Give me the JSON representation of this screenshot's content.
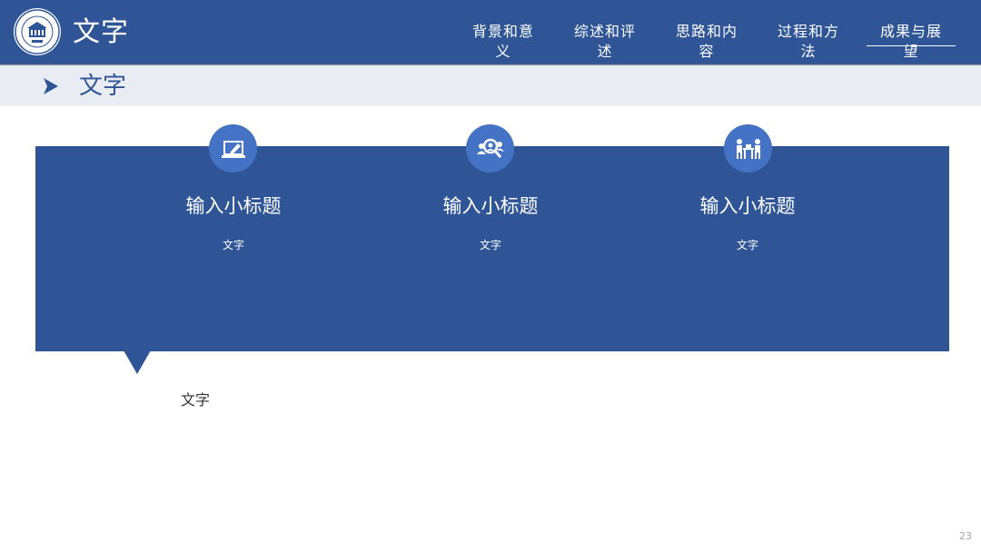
{
  "header": {
    "title": "文字",
    "logo_icon": "university-seal-icon",
    "colors": {
      "brand": "#2f5597",
      "light": "#e9edf3",
      "accent": "#4472c4"
    }
  },
  "nav": {
    "items": [
      {
        "label": "背景和意义",
        "active": false
      },
      {
        "label": "综述和评述",
        "active": false
      },
      {
        "label": "思路和内容",
        "active": false
      },
      {
        "label": "过程和方法",
        "active": false
      },
      {
        "label": "成果与展望",
        "active": true
      }
    ]
  },
  "section": {
    "title": "文字",
    "icon": "chevron-right-icon"
  },
  "features": [
    {
      "icon": "laptop-edit-icon",
      "title": "输入小标题",
      "text": "文字"
    },
    {
      "icon": "team-search-icon",
      "title": "输入小标题",
      "text": "文字"
    },
    {
      "icon": "meeting-icon",
      "title": "输入小标题",
      "text": "文字"
    }
  ],
  "body": {
    "text": "文字"
  },
  "footer": {
    "page_number": "23"
  }
}
